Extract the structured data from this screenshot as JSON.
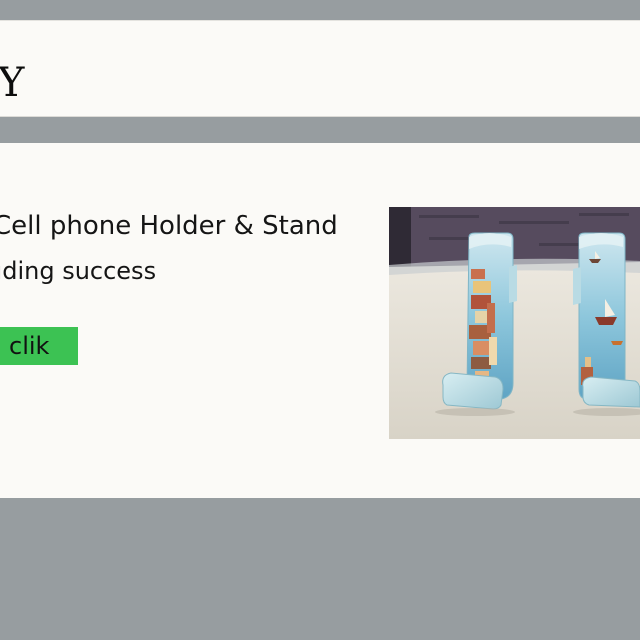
{
  "header": {
    "brand": "Y"
  },
  "product": {
    "title": "Cell phone Holder & Stand",
    "status": "uding success",
    "button_label": "clik"
  },
  "colors": {
    "background": "#979da0",
    "panel": "#fbfaf7",
    "button": "#3cc253",
    "text": "#151515"
  }
}
